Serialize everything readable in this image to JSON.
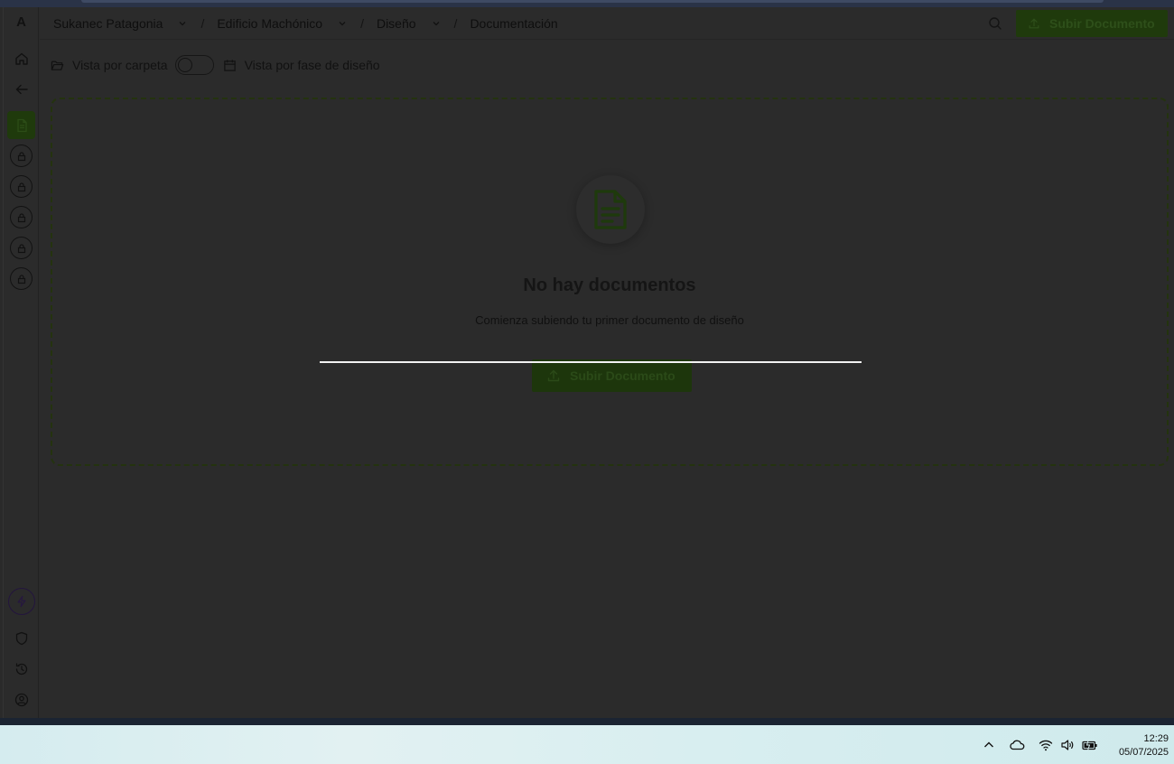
{
  "app": {
    "logo": "A"
  },
  "breadcrumb": [
    {
      "label": "Sukanec Patagonia"
    },
    {
      "label": "Edificio Machónico"
    },
    {
      "label": "Diseño"
    },
    {
      "label": "Documentación"
    }
  ],
  "breadcrumb_separator": "/",
  "header": {
    "upload_label": "Subir Documento"
  },
  "viewbar": {
    "folder_view_label": "Vista por carpeta",
    "phase_view_label": "Vista por fase de diseño",
    "toggle_on": false
  },
  "empty_state": {
    "title": "No hay documentos",
    "subtitle": "Comienza subiendo tu primer documento de diseño",
    "upload_label": "Subir Documento"
  },
  "taskbar": {
    "time": "12:29",
    "date": "05/07/2025"
  },
  "colors": {
    "accent": "#1f3a0c",
    "background": "#2b2b2b",
    "taskbar": "#d5ecef"
  }
}
